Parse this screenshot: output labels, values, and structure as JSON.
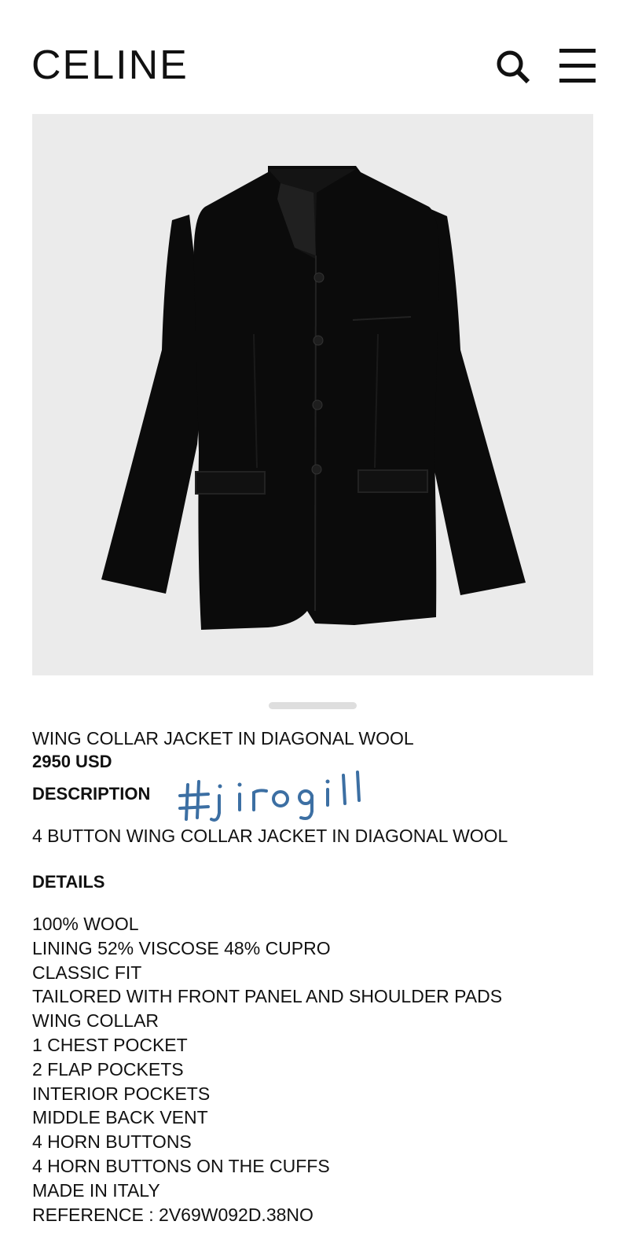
{
  "header": {
    "logo": "CELINE",
    "search_icon": "search-icon",
    "menu_icon": "hamburger-menu-icon"
  },
  "product": {
    "name": "WING COLLAR JACKET IN DIAGONAL WOOL",
    "price": "2950 USD",
    "image_bg": "#ebebeb",
    "watermark": "#jirogill",
    "description_title": "DESCRIPTION",
    "description": "4 BUTTON WING COLLAR JACKET IN DIAGONAL WOOL",
    "details_title": "DETAILS",
    "details": [
      "100% WOOL",
      "LINING 52% VISCOSE 48% CUPRO",
      "CLASSIC FIT",
      "TAILORED WITH FRONT PANEL AND SHOULDER PADS",
      "WING COLLAR",
      "1 CHEST POCKET",
      "2 FLAP POCKETS",
      "INTERIOR POCKETS",
      "MIDDLE BACK VENT",
      "4 HORN BUTTONS",
      "4 HORN BUTTONS ON THE CUFFS",
      "MADE IN ITALY",
      "REFERENCE : 2V69W092D.38NO"
    ]
  },
  "carousel": {
    "current_slide": 1
  }
}
